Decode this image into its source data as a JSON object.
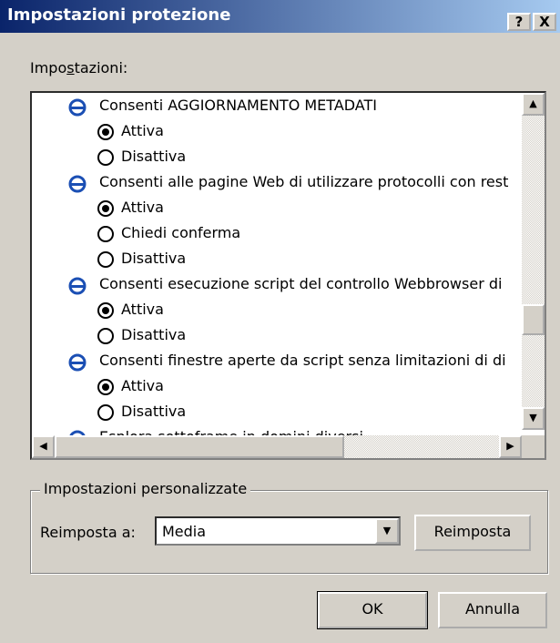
{
  "window": {
    "title": "Impostazioni protezione",
    "help": "?",
    "close": "X"
  },
  "settings_label": "Impostazioni:",
  "settings_accel": "s",
  "list": {
    "h1": "Consenti AGGIORNAMENTO METADATI",
    "h1_opt1": "Attiva",
    "h1_opt2": "Disattiva",
    "h2": "Consenti alle pagine Web di utilizzare protocolli con rest",
    "h2_opt1": "Attiva",
    "h2_opt2": "Chiedi conferma",
    "h2_opt3": "Disattiva",
    "h3": "Consenti esecuzione script del controllo Webbrowser di",
    "h3_opt1": "Attiva",
    "h3_opt2": "Disattiva",
    "h4": "Consenti finestre aperte da script senza limitazioni di di",
    "h4_opt1": "Attiva",
    "h4_opt2": "Disattiva",
    "h5": "Esplora sottoframe in domini diversi"
  },
  "custom": {
    "legend": "Impostazioni personalizzate",
    "reset_label": "Reimposta a:",
    "reset_value": "Media",
    "reset_button": "Reimposta"
  },
  "buttons": {
    "ok": "OK",
    "cancel": "Annulla"
  }
}
